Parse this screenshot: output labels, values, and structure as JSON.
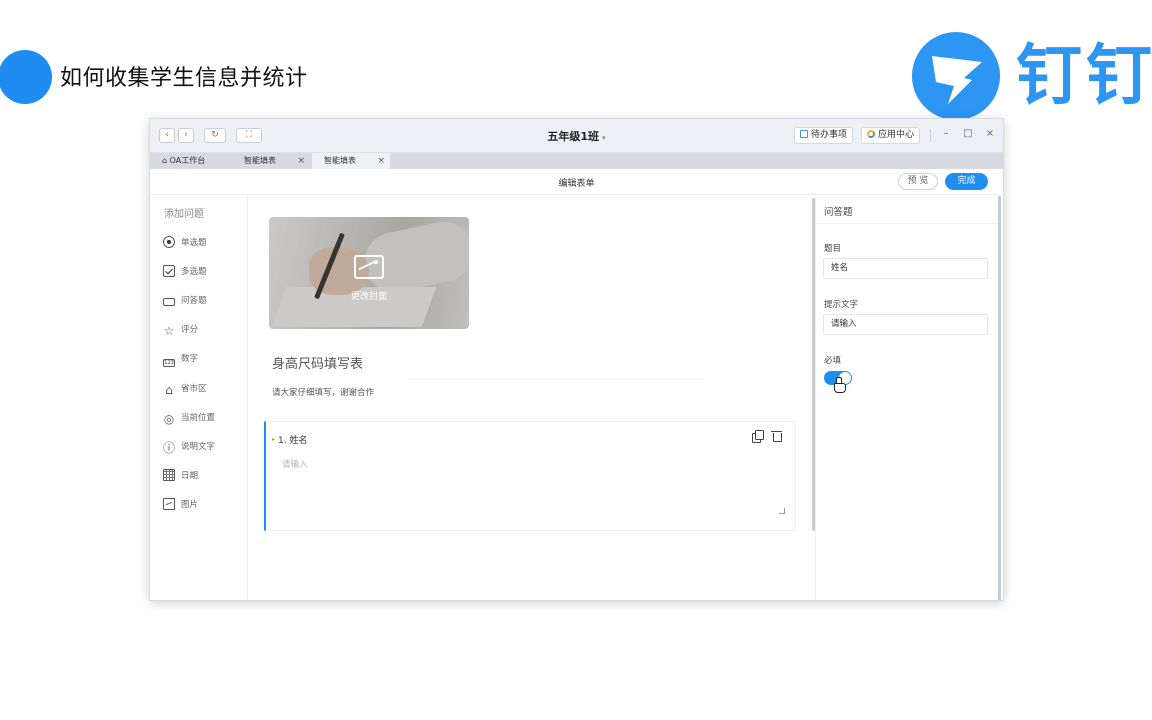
{
  "slide": {
    "title": "如何收集学生信息并统计",
    "brand_name": "钉钉"
  },
  "window": {
    "title": "五年级1班",
    "title_caret": "▾",
    "nav": {
      "back": "‹",
      "forward": "›",
      "refresh": "↻",
      "fullscreen": "⛶"
    },
    "todo_label": "待办事项",
    "app_center_label": "应用中心",
    "controls": {
      "minimize": "–",
      "maximize": "□",
      "close": "×"
    }
  },
  "tabs": [
    {
      "label": "⌂ OA工作台",
      "closable": false
    },
    {
      "label": "智能填表",
      "closable": true
    },
    {
      "label": "智能填表",
      "closable": true,
      "active": true
    }
  ],
  "tab_close": "×",
  "editor": {
    "title": "编辑表单",
    "preview_label": "预 览",
    "done_label": "完成"
  },
  "add_question": {
    "heading": "添加问题",
    "items": [
      {
        "label": "单选题",
        "icon": "radio-icon"
      },
      {
        "label": "多选题",
        "icon": "checkbox-icon"
      },
      {
        "label": "问答题",
        "icon": "textbox-icon"
      },
      {
        "label": "评分",
        "icon": "star-icon",
        "glyph": "☆"
      },
      {
        "label": "数字",
        "icon": "number-icon",
        "glyph": "123"
      },
      {
        "label": "省市区",
        "icon": "region-icon",
        "glyph": "⌂"
      },
      {
        "label": "当前位置",
        "icon": "location-icon",
        "glyph": "◎"
      },
      {
        "label": "说明文字",
        "icon": "info-icon",
        "glyph": "ⓘ"
      },
      {
        "label": "日期",
        "icon": "calendar-icon"
      },
      {
        "label": "图片",
        "icon": "image-icon"
      }
    ]
  },
  "form": {
    "cover_label": "更改封面",
    "title": "身高尺码填写表",
    "description": "请大家仔细填写，谢谢合作",
    "question": {
      "label": "1. 姓名",
      "placeholder": "请输入"
    }
  },
  "properties": {
    "heading": "问答题",
    "title_label": "题目",
    "title_value": "姓名",
    "hint_label": "提示文字",
    "hint_value": "请输入",
    "required_label": "必填",
    "required": true
  },
  "colors": {
    "accent": "#1f8ef1",
    "brand": "#2d95f2"
  }
}
